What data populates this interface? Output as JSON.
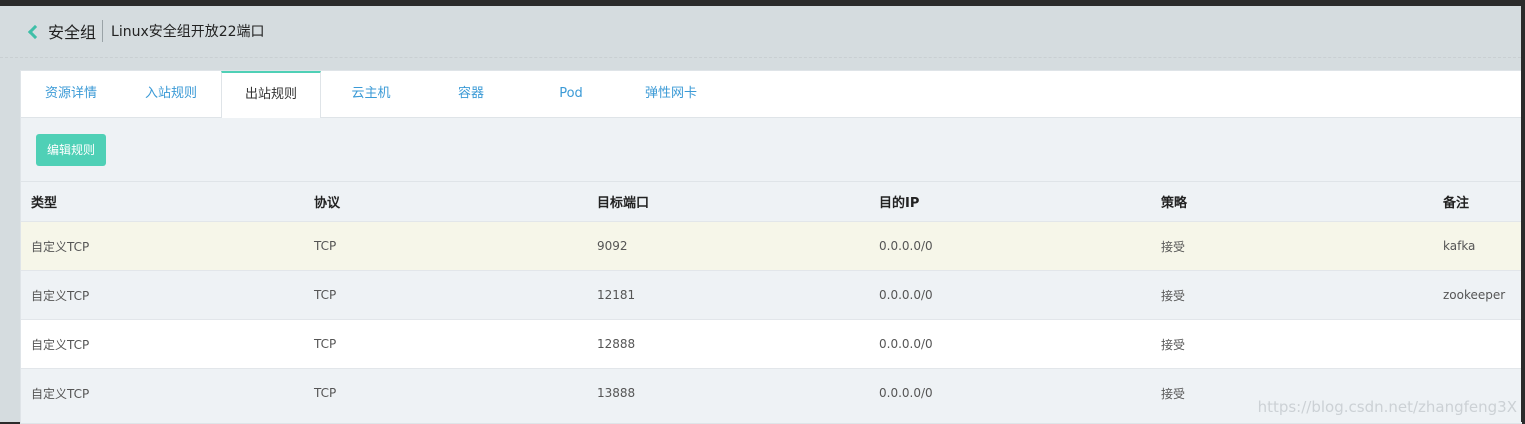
{
  "header": {
    "title": "安全组",
    "subtitle": "Linux安全组开放22端口"
  },
  "tabs": [
    {
      "label": "资源详情",
      "active": false
    },
    {
      "label": "入站规则",
      "active": false
    },
    {
      "label": "出站规则",
      "active": true
    },
    {
      "label": "云主机",
      "active": false
    },
    {
      "label": "容器",
      "active": false
    },
    {
      "label": "Pod",
      "active": false
    },
    {
      "label": "弹性网卡",
      "active": false
    }
  ],
  "toolbar": {
    "edit_label": "编辑规则"
  },
  "table": {
    "columns": [
      "类型",
      "协议",
      "目标端口",
      "目的IP",
      "策略",
      "备注"
    ],
    "rows": [
      [
        "自定义TCP",
        "TCP",
        "9092",
        "0.0.0.0/0",
        "接受",
        "kafka"
      ],
      [
        "自定义TCP",
        "TCP",
        "12181",
        "0.0.0.0/0",
        "接受",
        "zookeeper"
      ],
      [
        "自定义TCP",
        "TCP",
        "12888",
        "0.0.0.0/0",
        "接受",
        ""
      ],
      [
        "自定义TCP",
        "TCP",
        "13888",
        "0.0.0.0/0",
        "接受",
        ""
      ]
    ]
  },
  "watermark": "https://blog.csdn.net/zhangfeng3X",
  "colors": {
    "accent": "#4fd0b6",
    "link": "#3b9ad6",
    "highlight_row": "#f6f6e9"
  }
}
